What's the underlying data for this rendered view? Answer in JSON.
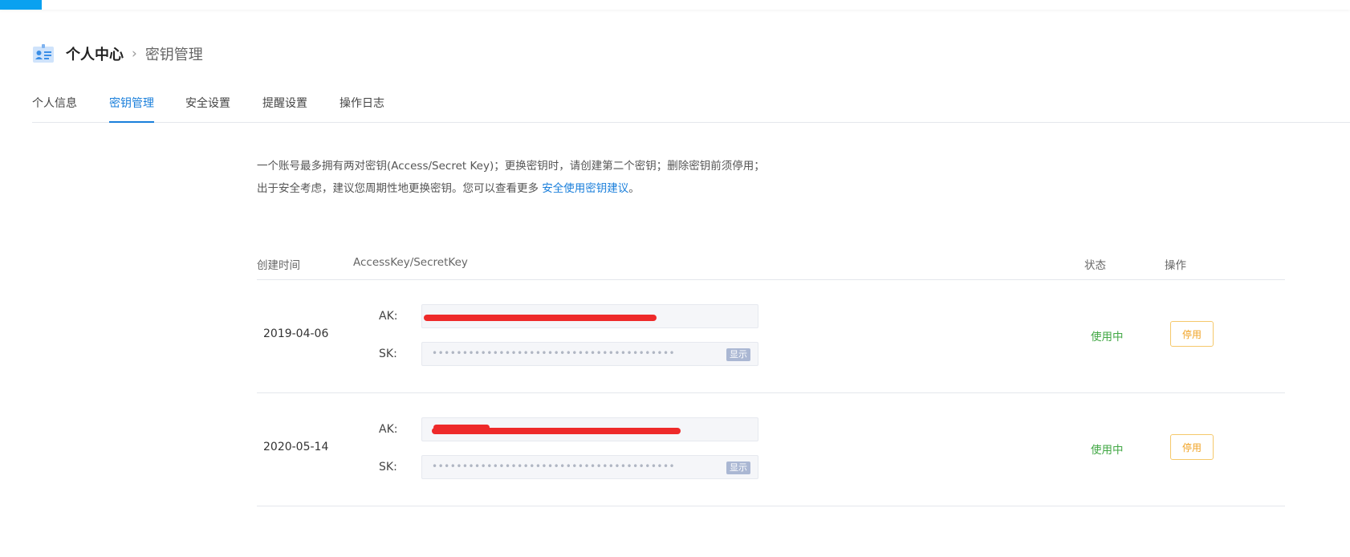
{
  "breadcrumb": {
    "root": "个人中心",
    "separator": "›",
    "current": "密钥管理"
  },
  "tabs": [
    {
      "label": "个人信息",
      "active": false
    },
    {
      "label": "密钥管理",
      "active": true
    },
    {
      "label": "安全设置",
      "active": false
    },
    {
      "label": "提醒设置",
      "active": false
    },
    {
      "label": "操作日志",
      "active": false
    }
  ],
  "notice": {
    "text": "一个账号最多拥有两对密钥(Access/Secret Key)；更换密钥时，请创建第二个密钥；删除密钥前须停用；出于安全考虑，建议您周期性地更换密钥。您可以查看更多 ",
    "link": "安全使用密钥建议",
    "tail": "。"
  },
  "table": {
    "headers": {
      "created": "创建时间",
      "keys": "AccessKey/SecretKey",
      "status": "状态",
      "action": "操作"
    },
    "ak_label": "AK:",
    "sk_label": "SK:",
    "show_label": "显示",
    "rows": [
      {
        "created": "2019-04-06",
        "ak": "",
        "sk": "••••••••••••••••••••••••••••••••••••••••",
        "status": "使用中",
        "action": "停用"
      },
      {
        "created": "2020-05-14",
        "ak": "",
        "sk": "••••••••••••••••••••••••••••••••••••••••",
        "status": "使用中",
        "action": "停用"
      }
    ]
  },
  "colors": {
    "accent": "#1a7fdb",
    "topbar_accent": "#0aa1f0",
    "status_active": "#42a845",
    "action_warning": "#f0a324",
    "redaction": "#ee2a2a"
  }
}
